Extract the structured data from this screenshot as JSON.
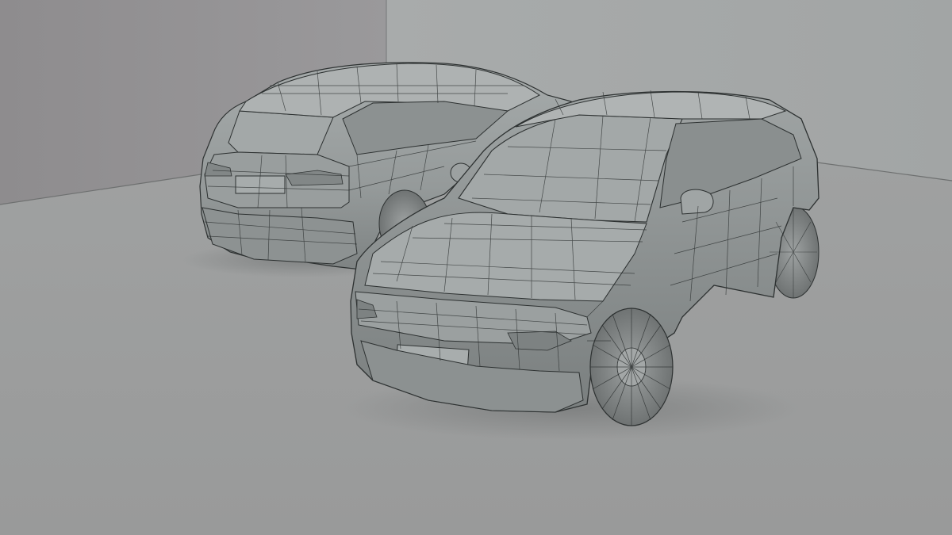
{
  "scene": {
    "kind": "3d-viewport-render",
    "subject": "two-suv-wireframe-models",
    "render_mode": "shaded-with-wireframe",
    "objects": [
      {
        "name": "rear-suv-model",
        "view": "rear-three-quarter"
      },
      {
        "name": "front-suv-model",
        "view": "front-three-quarter"
      }
    ]
  },
  "colors": {
    "floor": "#999a9a",
    "left_wall": "#929092",
    "right_wall": "#a3a6a6",
    "body_shade": "#959a9a",
    "body_light": "#a9adad",
    "body_dark": "#6f7474",
    "wire": "#2d3131",
    "tire": "#7c8080"
  }
}
